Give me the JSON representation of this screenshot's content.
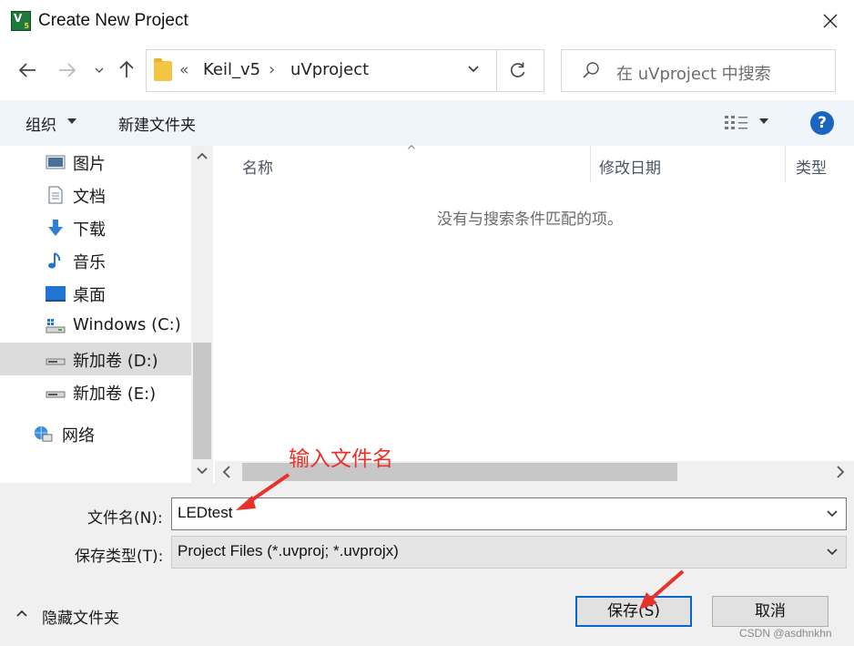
{
  "window": {
    "title": "Create New Project",
    "icon": "keil-uvision-icon"
  },
  "nav": {
    "breadcrumb_prefix": "«",
    "breadcrumbs": [
      "Keil_v5",
      "uVproject"
    ],
    "breadcrumb_separator": "›",
    "search_placeholder": "在 uVproject 中搜索"
  },
  "toolbar": {
    "organize_label": "组织",
    "new_folder_label": "新建文件夹"
  },
  "sidebar": {
    "items": [
      {
        "label": "图片",
        "icon": "pictures-icon"
      },
      {
        "label": "文档",
        "icon": "documents-icon"
      },
      {
        "label": "下载",
        "icon": "downloads-icon"
      },
      {
        "label": "音乐",
        "icon": "music-icon"
      },
      {
        "label": "桌面",
        "icon": "desktop-icon"
      },
      {
        "label": "Windows (C:)",
        "icon": "windows-drive-icon"
      },
      {
        "label": "新加卷 (D:)",
        "icon": "drive-icon",
        "selected": true
      },
      {
        "label": "新加卷 (E:)",
        "icon": "drive-icon"
      },
      {
        "label": "网络",
        "icon": "network-icon"
      }
    ]
  },
  "filelist": {
    "columns": [
      "名称",
      "修改日期",
      "类型"
    ],
    "empty_message": "没有与搜索条件匹配的项。"
  },
  "form": {
    "filename_label": "文件名(N):",
    "filename_value": "LEDtest",
    "filetype_label": "保存类型(T):",
    "filetype_value": "Project Files (*.uvproj; *.uvprojx)",
    "hide_folders_label": "隐藏文件夹",
    "save_label": "保存(S)",
    "cancel_label": "取消"
  },
  "annotation": {
    "text": "输入文件名",
    "color": "#e8312b"
  },
  "watermark": "CSDN @asdhnkhn",
  "colors": {
    "accent": "#0a66cc",
    "toolbar_bg": "#f0f5fb",
    "folder": "#f4c542",
    "annotation": "#e8312b"
  }
}
